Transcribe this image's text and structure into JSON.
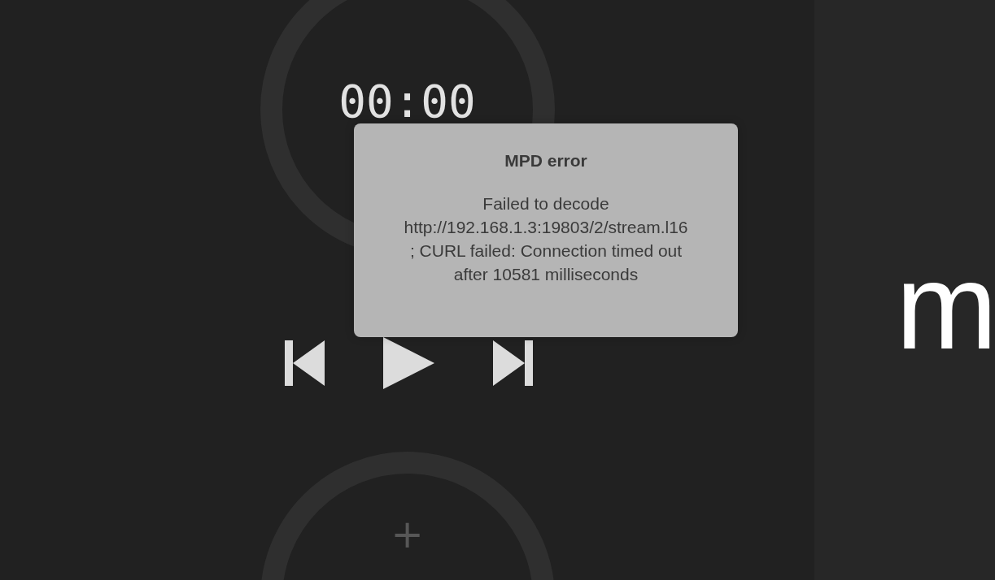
{
  "player": {
    "elapsed": "00:00",
    "add_button": "+"
  },
  "side_panel": {
    "text": "m"
  },
  "dialog": {
    "title": "MPD error",
    "message": "Failed to decode http://192.168.1.3:19803/2/stream.l16; CURL failed: Connection timed out after 10581 milliseconds"
  }
}
